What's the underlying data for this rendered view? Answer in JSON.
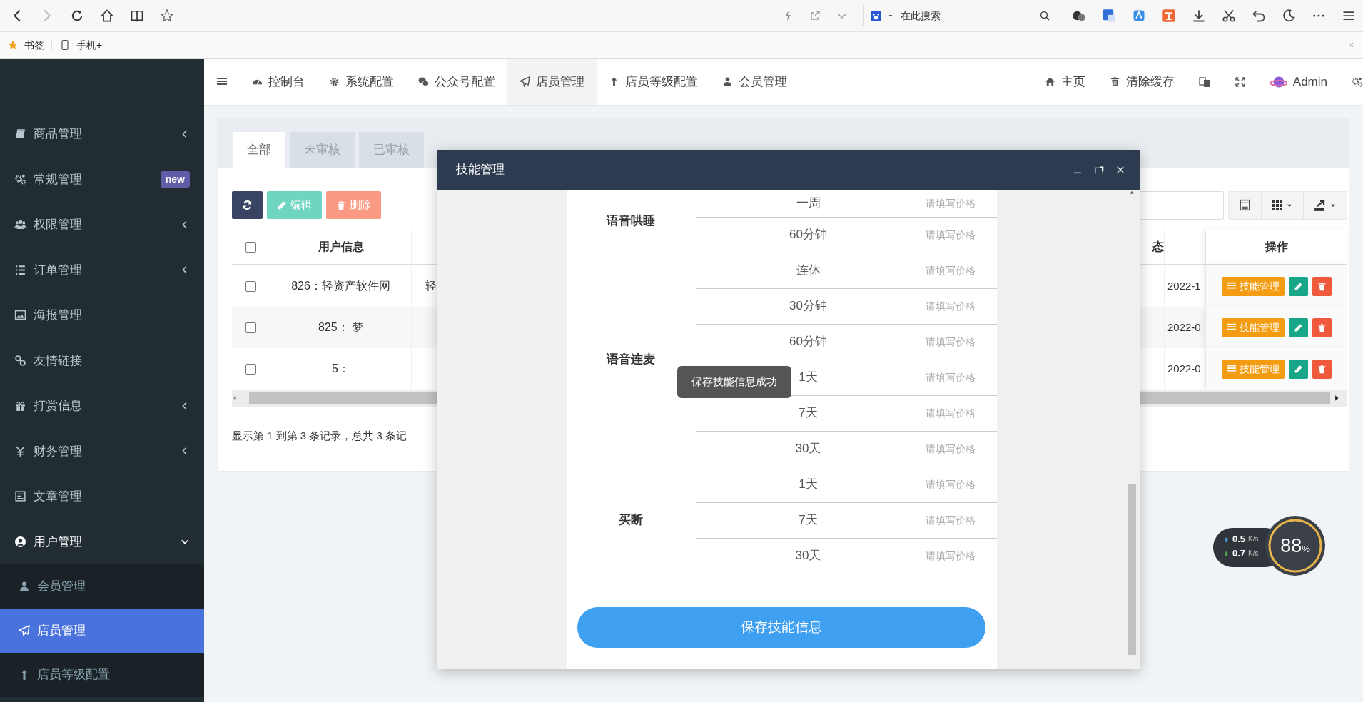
{
  "browser": {
    "search_placeholder": "在此搜索",
    "bookmarks": [
      {
        "label": "书签",
        "kind": "star"
      },
      {
        "label": "手机+",
        "kind": "phone"
      }
    ]
  },
  "sidebar": {
    "items": [
      {
        "label": "商品管理",
        "kind": "group",
        "expanded": false,
        "selected": false
      },
      {
        "label": "常规管理",
        "kind": "link",
        "badge": "new",
        "selected": false
      },
      {
        "label": "权限管理",
        "kind": "group",
        "expanded": false,
        "selected": false
      },
      {
        "label": "订单管理",
        "kind": "group",
        "expanded": false,
        "selected": false
      },
      {
        "label": "海报管理",
        "kind": "link",
        "selected": false
      },
      {
        "label": "友情链接",
        "kind": "link",
        "selected": false
      },
      {
        "label": "打赏信息",
        "kind": "group",
        "expanded": false,
        "selected": false
      },
      {
        "label": "财务管理",
        "kind": "group",
        "expanded": false,
        "selected": false
      },
      {
        "label": "文章管理",
        "kind": "link",
        "selected": false
      },
      {
        "label": "用户管理",
        "kind": "group",
        "expanded": true,
        "selected": false,
        "children": [
          {
            "label": "会员管理",
            "selected": false
          },
          {
            "label": "店员管理",
            "selected": true
          },
          {
            "label": "店员等级配置",
            "selected": false
          }
        ]
      }
    ]
  },
  "topnav": {
    "items": [
      {
        "label": "控制台",
        "selected": false
      },
      {
        "label": "系统配置",
        "selected": false
      },
      {
        "label": "公众号配置",
        "selected": false
      },
      {
        "label": "店员管理",
        "selected": true
      },
      {
        "label": "店员等级配置",
        "selected": false
      },
      {
        "label": "会员管理",
        "selected": false
      }
    ],
    "links": [
      {
        "label": "主页"
      },
      {
        "label": "清除缓存"
      }
    ],
    "user": "Admin"
  },
  "tabs": [
    {
      "label": "全部",
      "selected": true
    },
    {
      "label": "未审核",
      "selected": false
    },
    {
      "label": "已审核",
      "selected": false
    }
  ],
  "toolbar": [
    {
      "kind": "refresh",
      "disabled": false
    },
    {
      "kind": "edit",
      "label": "编辑",
      "disabled": true
    },
    {
      "kind": "delete",
      "label": "删除",
      "disabled": true
    }
  ],
  "table": {
    "header_checked": false,
    "headers": {
      "user_info": "用户信息",
      "column_4": "态",
      "actions": "操作"
    },
    "rows": [
      {
        "checked": false,
        "user_info": "826：轻资产软件网",
        "column_3": "轻",
        "column_5": "2022-1",
        "action": "技能管理"
      },
      {
        "checked": false,
        "user_info": "825：  梦",
        "column_5": "2022-0",
        "action": "技能管理"
      },
      {
        "checked": false,
        "user_info": "5：",
        "column_5": "2022-0",
        "action": "技能管理"
      }
    ]
  },
  "footer": "显示第 1 到第 3 条记录，总共 3 条记",
  "modal": {
    "title": "技能管理",
    "groups": [
      {
        "label": "语音哄睡",
        "options": [
          {
            "duration": "一周",
            "placeholder": "请填写价格"
          },
          {
            "duration": "60分钟",
            "placeholder": "请填写价格"
          }
        ]
      },
      {
        "label": "语音连麦",
        "options": [
          {
            "duration": "连休",
            "placeholder": "请填写价格"
          },
          {
            "duration": "30分钟",
            "placeholder": "请填写价格"
          },
          {
            "duration": "60分钟",
            "placeholder": "请填写价格"
          },
          {
            "duration": "1天",
            "placeholder": "请填写价格"
          },
          {
            "duration": "7天",
            "placeholder": "请填写价格"
          },
          {
            "duration": "30天",
            "placeholder": "请填写价格"
          }
        ]
      },
      {
        "label": "买断",
        "options": [
          {
            "duration": "1天",
            "placeholder": "请填写价格"
          },
          {
            "duration": "7天",
            "placeholder": "请填写价格"
          },
          {
            "duration": "30天",
            "placeholder": "请填写价格"
          }
        ]
      }
    ],
    "save_button": "保存技能信息",
    "toast": "保存技能信息成功"
  },
  "network": {
    "up": "0.5",
    "down": "0.7",
    "unit_up": "K/s",
    "unit_down": "K/s",
    "percent": "88",
    "percent_sign": "%"
  }
}
